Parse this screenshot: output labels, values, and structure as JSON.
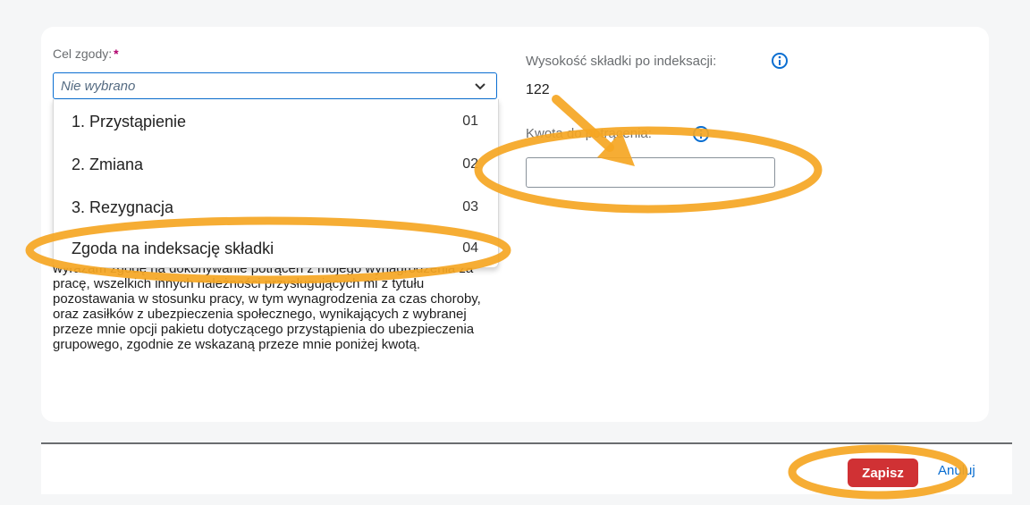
{
  "form": {
    "purpose": {
      "label": "Cel zgody:",
      "required_mark": "*",
      "selected_value": "Nie wybrano",
      "options": [
        {
          "label": "1. Przystąpienie",
          "key": "01"
        },
        {
          "label": "2. Zmiana",
          "key": "02"
        },
        {
          "label": "3. Rezygnacja",
          "key": "03"
        },
        {
          "label": "Zgoda na indeksację składki",
          "key": "04"
        }
      ]
    },
    "consent_text": "wyrażam zgodę na dokonywanie potrąceń z mojego wynagrodzenia za pracę, wszelkich innych należności przysługujących mi z tytułu pozostawania w stosunku pracy, w tym wynagrodzenia za czas choroby, oraz zasiłków z ubezpieczenia społecznego, wynikających z wybranej przeze mnie opcji pakietu dotyczącego przystąpienia do ubezpieczenia grupowego, zgodnie ze wskazaną przeze mnie poniżej kwotą.",
    "premium": {
      "label": "Wysokość składki po indeksacji:",
      "value": "122"
    },
    "deduction": {
      "label": "Kwota do potrącenia:",
      "value": ""
    }
  },
  "footer": {
    "save_label": "Zapisz",
    "cancel_label": "Anuluj"
  },
  "colors": {
    "accent": "#0a6ed1",
    "save": "#d03134",
    "annotation": "#f5a623",
    "required": "#b0006c"
  },
  "icons": [
    "chevron-down-icon",
    "info-icon",
    "arrow-annotation",
    "circle-annotation"
  ]
}
